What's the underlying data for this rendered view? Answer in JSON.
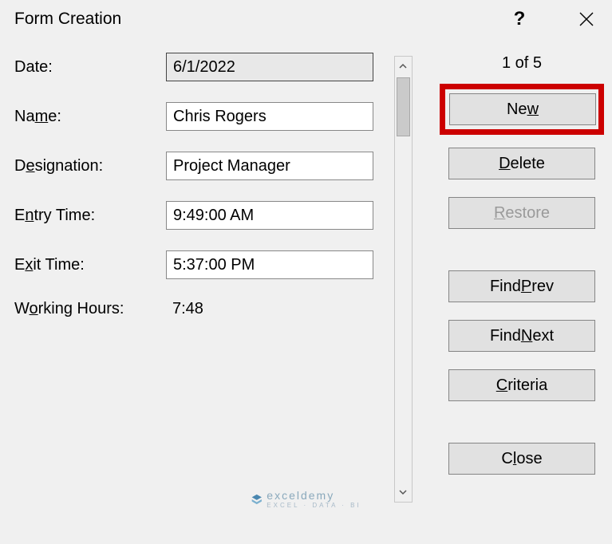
{
  "dialog": {
    "title": "Form Creation",
    "help": "?",
    "close": "×"
  },
  "fields": {
    "date": {
      "label": "Date:",
      "value": "6/1/2022"
    },
    "name": {
      "label": "Name:",
      "value": "Chris Rogers"
    },
    "designation": {
      "label": "Designation:",
      "value": "Project Manager"
    },
    "entry_time": {
      "label": "Entry Time:",
      "value": "9:49:00 AM"
    },
    "exit_time": {
      "label": "Exit Time:",
      "value": "5:37:00 PM"
    },
    "working_hours": {
      "label": "Working Hours:",
      "value": "7:48"
    }
  },
  "record_counter": "1 of 5",
  "buttons": {
    "new": {
      "pre": "Ne",
      "u": "w",
      "post": ""
    },
    "delete": {
      "pre": "",
      "u": "D",
      "post": "elete"
    },
    "restore": {
      "pre": "",
      "u": "R",
      "post": "estore"
    },
    "find_prev": {
      "pre": "Find ",
      "u": "P",
      "post": "rev"
    },
    "find_next": {
      "pre": "Find ",
      "u": "N",
      "post": "ext"
    },
    "criteria": {
      "pre": "",
      "u": "C",
      "post": "riteria"
    },
    "close": {
      "pre": "C",
      "u": "l",
      "post": "ose"
    }
  },
  "labels_underline": {
    "name": {
      "pre": "Na",
      "u": "m",
      "post": "e:"
    },
    "designation": {
      "pre": "D",
      "u": "e",
      "post": "signation:"
    },
    "entry_time": {
      "pre": "E",
      "u": "n",
      "post": "try Time:"
    },
    "exit_time": {
      "pre": "E",
      "u": "x",
      "post": "it Time:"
    },
    "working_hours": {
      "pre": "W",
      "u": "o",
      "post": "rking Hours:"
    }
  },
  "watermark": {
    "brand": "exceldemy",
    "sub": "EXCEL · DATA · BI"
  }
}
